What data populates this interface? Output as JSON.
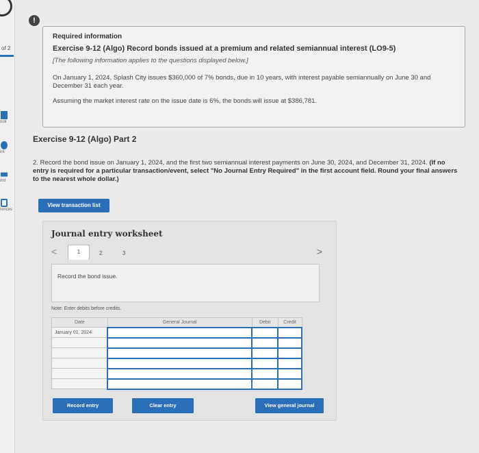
{
  "rail": {
    "pages": "of 2",
    "items": [
      {
        "label": "ook",
        "icon": "book-icon"
      },
      {
        "label": "int",
        "icon": "hint-icon"
      },
      {
        "label": "rint",
        "icon": "print-icon"
      },
      {
        "label": "rences",
        "icon": "references-icon"
      }
    ]
  },
  "alert": {
    "symbol": "!"
  },
  "info": {
    "heading": "Required information",
    "title": "Exercise 9-12 (Algo) Record bonds issued at a premium and related semiannual interest (LO9-5)",
    "note": "[The following information applies to the questions displayed below.]",
    "p1": "On January 1, 2024, Splash City issues $360,000 of 7% bonds, due in 10 years, with interest payable semiannually on June 30 and December 31 each year.",
    "p2": "Assuming the market interest rate on the issue date is 6%, the bonds will issue at $386,781."
  },
  "part": {
    "title": "Exercise 9-12 (Algo) Part 2",
    "question_plain": "2. Record the bond issue on January 1, 2024, and the first two semiannual interest payments on June 30, 2024, and December 31, 2024.",
    "question_bold": "(If no entry is required for a particular transaction/event, select \"No Journal Entry Required\" in the first account field. Round your final answers to the nearest whole dollar.)"
  },
  "view_transaction_label": "View transaction list",
  "worksheet": {
    "title": "Journal entry worksheet",
    "prev": "<",
    "next": ">",
    "tabs": [
      "1",
      "2",
      "3"
    ],
    "description": "Record the bond issue.",
    "note": "Note: Enter debits before credits.",
    "columns": [
      "Date",
      "General Journal",
      "Debit",
      "Credit"
    ],
    "rows": [
      {
        "date": "January 01, 2024",
        "account": "",
        "debit": "",
        "credit": ""
      },
      {
        "date": "",
        "account": "",
        "debit": "",
        "credit": ""
      },
      {
        "date": "",
        "account": "",
        "debit": "",
        "credit": ""
      },
      {
        "date": "",
        "account": "",
        "debit": "",
        "credit": ""
      },
      {
        "date": "",
        "account": "",
        "debit": "",
        "credit": ""
      },
      {
        "date": "",
        "account": "",
        "debit": "",
        "credit": ""
      }
    ],
    "record_label": "Record entry",
    "clear_label": "Clear entry",
    "view_journal_label": "View general journal"
  },
  "colors": {
    "accent": "#2a6fb7",
    "panel": "#e3e3e3"
  }
}
